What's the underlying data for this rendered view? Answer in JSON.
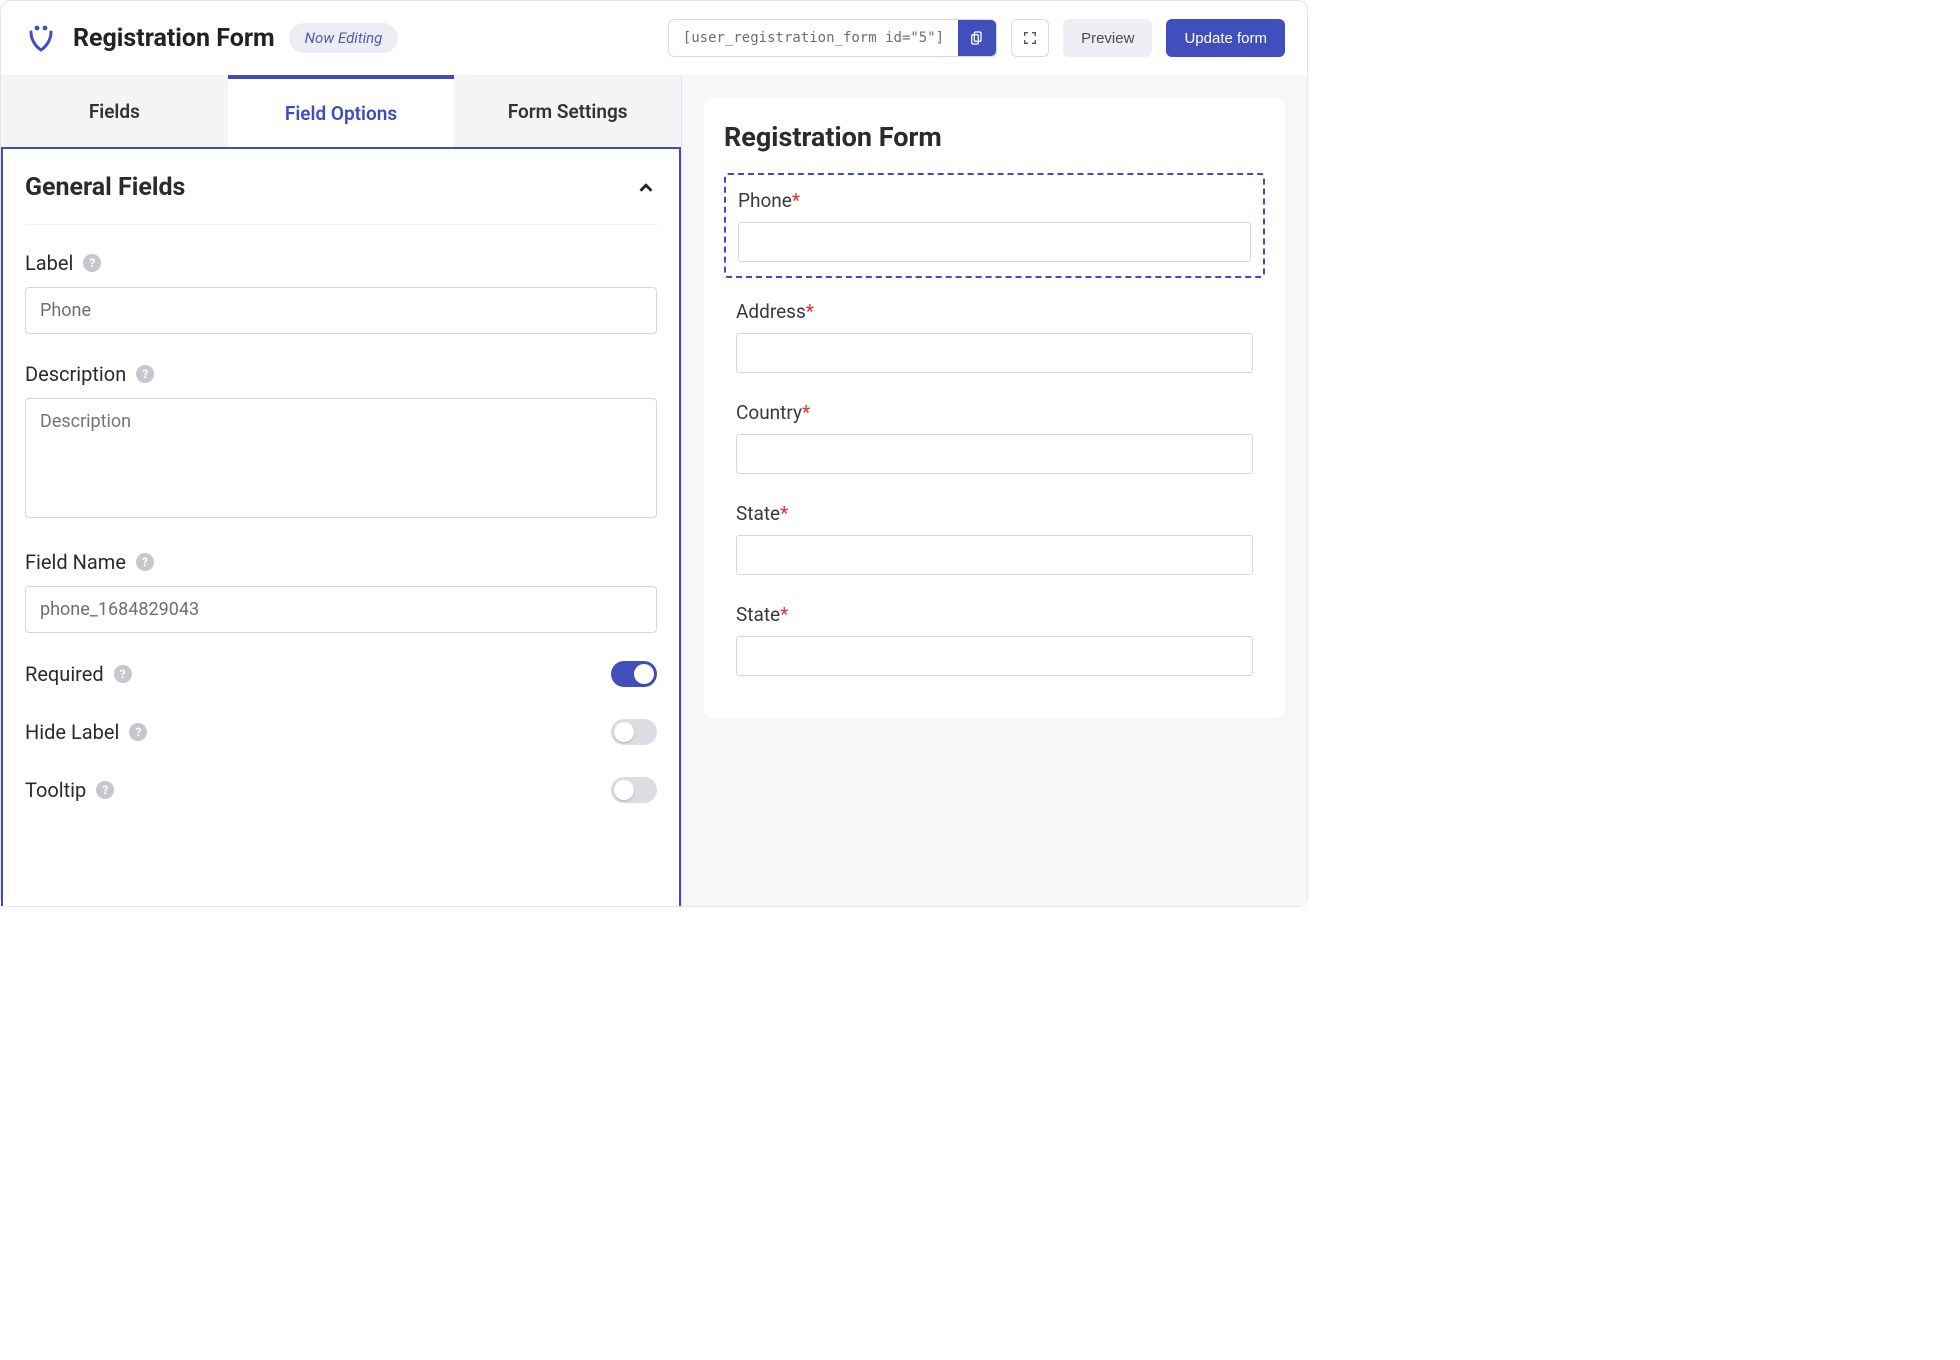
{
  "header": {
    "title": "Registration Form",
    "badge": "Now Editing",
    "shortcode": "[user_registration_form id=\"5\"]",
    "preview_label": "Preview",
    "update_label": "Update form"
  },
  "tabs": {
    "fields": "Fields",
    "field_options": "Field Options",
    "form_settings": "Form Settings"
  },
  "options": {
    "section_title": "General Fields",
    "label": {
      "label": "Label",
      "value": "Phone"
    },
    "description": {
      "label": "Description",
      "placeholder": "Description",
      "value": ""
    },
    "field_name": {
      "label": "Field Name",
      "value": "phone_1684829043"
    },
    "required": {
      "label": "Required",
      "on": true
    },
    "hide_label": {
      "label": "Hide Label",
      "on": false
    },
    "tooltip": {
      "label": "Tooltip",
      "on": false
    }
  },
  "preview": {
    "title": "Registration Form",
    "fields": [
      {
        "label": "Phone",
        "required": true,
        "selected": true
      },
      {
        "label": "Address",
        "required": true,
        "selected": false
      },
      {
        "label": "Country",
        "required": true,
        "selected": false
      },
      {
        "label": "State",
        "required": true,
        "selected": false
      },
      {
        "label": "State",
        "required": true,
        "selected": false
      }
    ]
  }
}
